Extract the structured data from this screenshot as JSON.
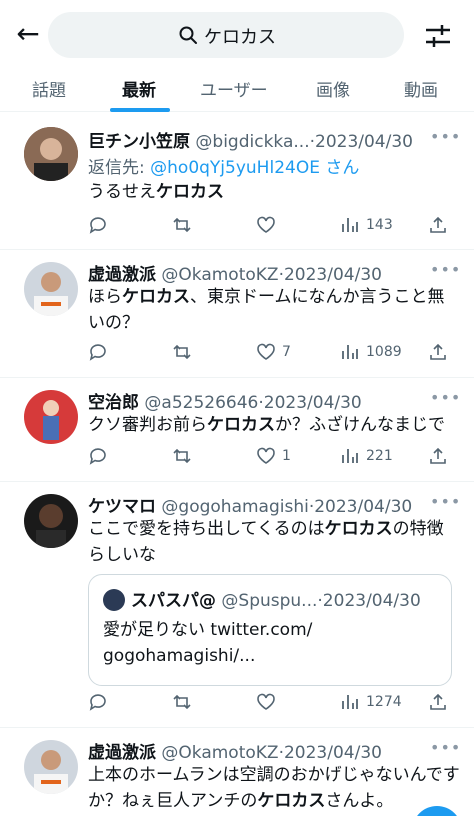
{
  "search": {
    "query": "ケロカス"
  },
  "tabs": [
    {
      "label": "話題"
    },
    {
      "label": "最新"
    },
    {
      "label": "ユーザー"
    },
    {
      "label": "画像"
    },
    {
      "label": "動画"
    }
  ],
  "tweets": [
    {
      "name": "巨チン小笠原",
      "handle": "@bigdickka...",
      "date": "·2023/04/30",
      "reply_prefix": "返信先: ",
      "reply_to": "@ho0qYj5yuHl24OE",
      "reply_suffix": "さん",
      "text_pre": "うるせえ",
      "text_bold": "ケロカス",
      "text_post": "",
      "retweets": "",
      "likes": "",
      "views": "143"
    },
    {
      "name": "虚過激派",
      "handle": "@OkamotoKZ",
      "date": "·2023/04/30",
      "text_pre": "ほら",
      "text_bold": "ケロカス",
      "text_post": "、東京ドームになんか言うこと無いの？",
      "likes": "7",
      "views": "1089"
    },
    {
      "name": "空治郎",
      "handle": "@a52526646",
      "date": "·2023/04/30",
      "text_pre": "クソ審判お前ら",
      "text_bold": "ケロカス",
      "text_post": "か？ふざけんなまじで",
      "likes": "1",
      "views": "221"
    },
    {
      "name": "ケツマロ",
      "handle": "@gogohamagishi",
      "date": "·2023/04/30",
      "text_pre": "ここで愛を持ち出してくるのは",
      "text_bold": "ケロカス",
      "text_post": "の特徴らしいな",
      "quote": {
        "name": "スパスパ@",
        "handle": "@Spuspu...",
        "date": "·2023/04/30",
        "text_line1": "愛が足りない twitter.com/",
        "text_line2": "gogohamagishi/..."
      },
      "views": "1274"
    },
    {
      "name": "虚過激派",
      "handle": "@OkamotoKZ",
      "date": "·2023/04/30",
      "text_pre": "上本のホームランは空調のおかげじゃないんですか？ねぇ巨人アンチの",
      "text_bold": "ケロカス",
      "text_post": "さんよ。"
    }
  ],
  "icons": {
    "back": "arrow-left-icon",
    "search": "search-icon",
    "settings": "settings-sliders-icon",
    "reply": "reply-bubble-icon",
    "retweet": "retweet-icon",
    "like": "heart-icon",
    "views": "views-bar-icon",
    "share": "share-icon"
  },
  "colors": {
    "accent": "#1d9bf0",
    "text": "#0f1419",
    "muted": "#536471"
  }
}
